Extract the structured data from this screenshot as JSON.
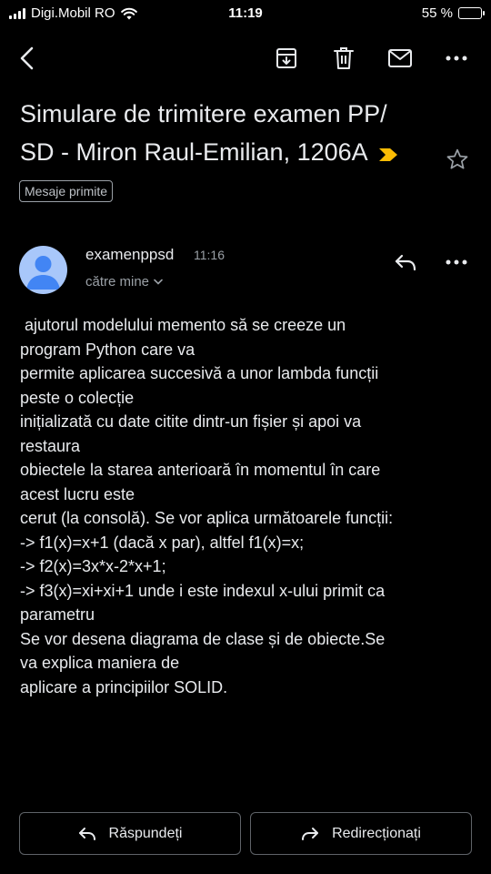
{
  "status_bar": {
    "carrier": "Digi.Mobil RO",
    "time": "11:19",
    "battery_text": "55 %",
    "battery_level": 0.55
  },
  "toolbar": {
    "back_icon": "back-arrow-icon",
    "archive_icon": "archive-icon",
    "delete_icon": "trash-icon",
    "mark_unread_icon": "mail-icon",
    "more_icon": "more-horizontal-icon"
  },
  "email": {
    "subject_lines": [
      "Simulare de trimitere examen PP/",
      "SD - Miron Raul-Emilian, 1206A"
    ],
    "label": "Mesaje primite",
    "sender": "examenppsd",
    "time": "11:16",
    "recipient": "către mine",
    "body_lines": [
      " ajutorul modelului memento să se creeze un",
      "program Python care va",
      "permite aplicarea succesivă a unor lambda funcții",
      "peste o colecție",
      "inițializată cu date citite dintr-un fișier și apoi va",
      "restaura",
      "obiectele la starea anterioară în momentul în care",
      "acest lucru este",
      "cerut (la consolă). Se vor aplica următoarele funcții:",
      "-> f1(x)=x+1 (dacă x par), altfel f1(x)=x;",
      "-> f2(x)=3x*x-2*x+1;",
      "-> f3(x)=xi+xi+1 unde i este indexul x-ului primit ca",
      "parametru",
      "Se vor desena diagrama de clase și de obiecte.Se",
      "va explica maniera de",
      "aplicare a principiilor SOLID."
    ]
  },
  "actions": {
    "reply_label": "Răspundeți",
    "forward_label": "Redirecționați"
  },
  "colors": {
    "background": "#000000",
    "text": "#e8eaed",
    "muted": "#9aa0a6",
    "avatar_bg": "#a8c7fa",
    "avatar_fg": "#4285f4",
    "importance": "#fbbc04",
    "button_border": "#5f6368"
  }
}
